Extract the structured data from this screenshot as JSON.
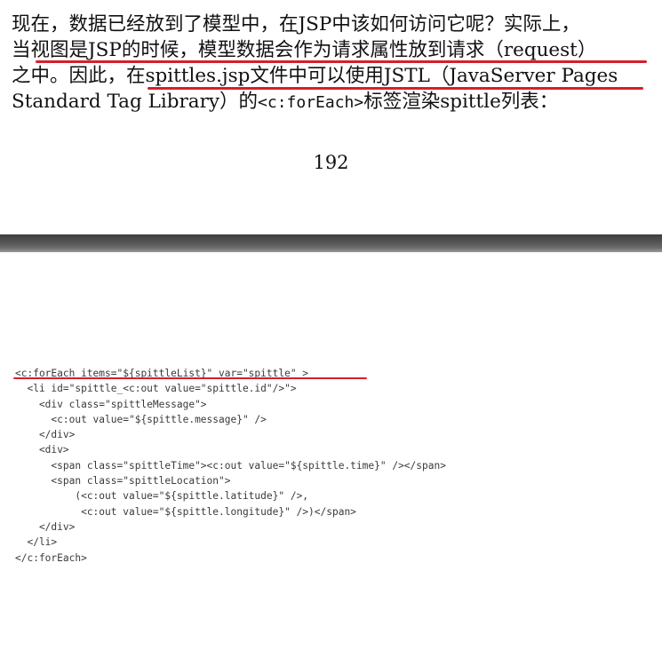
{
  "paragraph": {
    "line1": "现在，数据已经放到了模型中，在JSP中该如何访问它呢？实际上，",
    "line2": "当视图是JSP的时候，模型数据会作为请求属性放到请求（request）",
    "line3": "之中。因此，在spittles.jsp文件中可以使用JSTL（JavaServer Pages",
    "line4_before": "Standard Tag Library）的",
    "line4_code": "<c:forEach>",
    "line4_after": "标签渲染spittle列表："
  },
  "page_number": "192",
  "code_lines": [
    "<c:forEach items=\"${spittleList}\" var=\"spittle\" >",
    "  <li id=\"spittle_<c:out value=\"spittle.id\"/>\">",
    "    <div class=\"spittleMessage\">",
    "      <c:out value=\"${spittle.message}\" />",
    "    </div>",
    "    <div>",
    "      <span class=\"spittleTime\"><c:out value=\"${spittle.time}\" /></span>",
    "      <span class=\"spittleLocation\">",
    "          (<c:out value=\"${spittle.latitude}\" />,",
    "           <c:out value=\"${spittle.longitude}\" />)</span>",
    "    </div>",
    "  </li>",
    "</c:forEach>"
  ],
  "colors": {
    "annotation_red": "#d61f2c",
    "page_divider": "#555555",
    "code_text": "#3a3a3a"
  }
}
